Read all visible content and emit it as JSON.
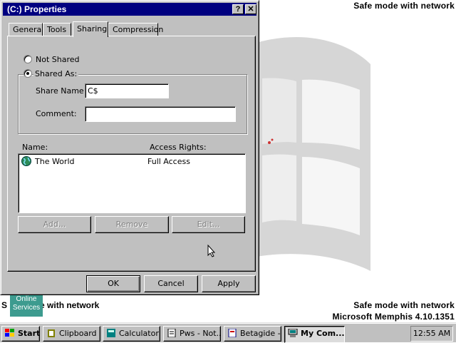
{
  "desktop": {
    "safe_mode_top": "Safe mode with network",
    "safe_mode_bottom": "Safe mode with network",
    "build_info": "Microsoft Memphis 4.10.1351",
    "safe_mode_left": "Safe mode with network",
    "left_text_prefix": "S",
    "left_text_suffix": "e with network",
    "online_services_label": "Online Services"
  },
  "window": {
    "title": "(C:) Properties",
    "help_button": "?",
    "close_button": "✕",
    "tabs": [
      {
        "label": "General",
        "active": false
      },
      {
        "label": "Tools",
        "active": false
      },
      {
        "label": "Sharing",
        "active": true
      },
      {
        "label": "Compression",
        "active": false
      }
    ],
    "sharing": {
      "not_shared_label": "Not Shared",
      "shared_as_label": "Shared As:",
      "selected": "Shared As:",
      "share_name_label": "Share Name:",
      "share_name_value": "C$",
      "comment_label": "Comment:",
      "comment_value": "",
      "list_header_name": "Name:",
      "list_header_access": "Access Rights:",
      "entries": [
        {
          "name": "The World",
          "access": "Full Access",
          "icon": "globe-icon"
        }
      ],
      "add_button": "Add...",
      "remove_button": "Remove",
      "edit_button": "Edit..."
    },
    "ok_button": "OK",
    "cancel_button": "Cancel",
    "apply_button": "Apply"
  },
  "taskbar": {
    "start_label": "Start",
    "tasks": [
      {
        "label": "Clipboard ...",
        "icon": "clipboard-icon",
        "active": false
      },
      {
        "label": "Calculator",
        "icon": "calculator-icon",
        "active": false
      },
      {
        "label": "Pws - Not...",
        "icon": "notepad-icon",
        "active": false
      },
      {
        "label": "Betagide -...",
        "icon": "document-icon",
        "active": false
      },
      {
        "label": "My Com...",
        "icon": "computer-icon",
        "active": true
      }
    ],
    "clock": "12:55 AM"
  },
  "colors": {
    "titlebar": "#000080",
    "face": "#c0c0c0",
    "desktop": "#ffffff",
    "online_services": "#3d9b8f"
  }
}
